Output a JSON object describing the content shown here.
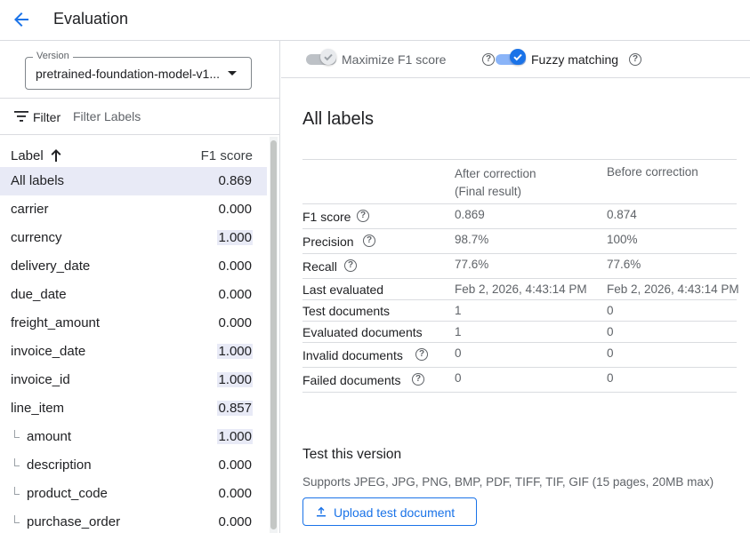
{
  "header": {
    "title": "Evaluation",
    "back_icon": "arrow-back-icon"
  },
  "version": {
    "label": "Version",
    "value": "pretrained-foundation-model-v1..."
  },
  "filter": {
    "label": "Filter",
    "placeholder": "Filter Labels"
  },
  "label_list": {
    "label_header": "Label",
    "score_header": "F1 score",
    "items": [
      {
        "label": "All labels",
        "score": "0.869"
      },
      {
        "label": "carrier",
        "score": "0.000"
      },
      {
        "label": "currency",
        "score": "1.000"
      },
      {
        "label": "delivery_date",
        "score": "0.000"
      },
      {
        "label": "due_date",
        "score": "0.000"
      },
      {
        "label": "freight_amount",
        "score": "0.000"
      },
      {
        "label": "invoice_date",
        "score": "1.000"
      },
      {
        "label": "invoice_id",
        "score": "1.000"
      },
      {
        "label": "line_item",
        "score": "0.857"
      },
      {
        "label": "amount",
        "score": "1.000"
      },
      {
        "label": "description",
        "score": "0.000"
      },
      {
        "label": "product_code",
        "score": "0.000"
      },
      {
        "label": "purchase_order",
        "score": "0.000"
      }
    ]
  },
  "toggles": {
    "maximize": {
      "label": "Maximize F1 score",
      "enabled": false
    },
    "fuzzy": {
      "label": "Fuzzy matching",
      "enabled": true
    }
  },
  "metrics": {
    "title": "All labels",
    "col_after": "After correction",
    "col_after_sub": "(Final result)",
    "col_before": "Before correction",
    "rows": [
      {
        "label": "F1 score",
        "after": "0.869",
        "before": "0.874"
      },
      {
        "label": "Precision",
        "after": "98.7%",
        "before": "100%"
      },
      {
        "label": "Recall",
        "after": "77.6%",
        "before": "77.6%"
      },
      {
        "label": "Last evaluated",
        "after": "Feb 2, 2026, 4:43:14 PM",
        "before": "Feb 2, 2026, 4:43:14 PM"
      },
      {
        "label": "Test documents",
        "after": "1",
        "before": "0"
      },
      {
        "label": "Evaluated documents",
        "after": "1",
        "before": "0"
      },
      {
        "label": "Invalid documents",
        "after": "0",
        "before": "0"
      },
      {
        "label": "Failed documents",
        "after": "0",
        "before": "0"
      }
    ]
  },
  "test": {
    "title": "Test this version",
    "subtitle": "Supports JPEG, JPG, PNG, BMP, PDF, TIFF, TIF, GIF (15 pages, 20MB max)",
    "button": "Upload test document"
  },
  "colors": {
    "accent": "#1a73e8",
    "selected": "#e8eaf6",
    "divider": "#dadce0"
  }
}
